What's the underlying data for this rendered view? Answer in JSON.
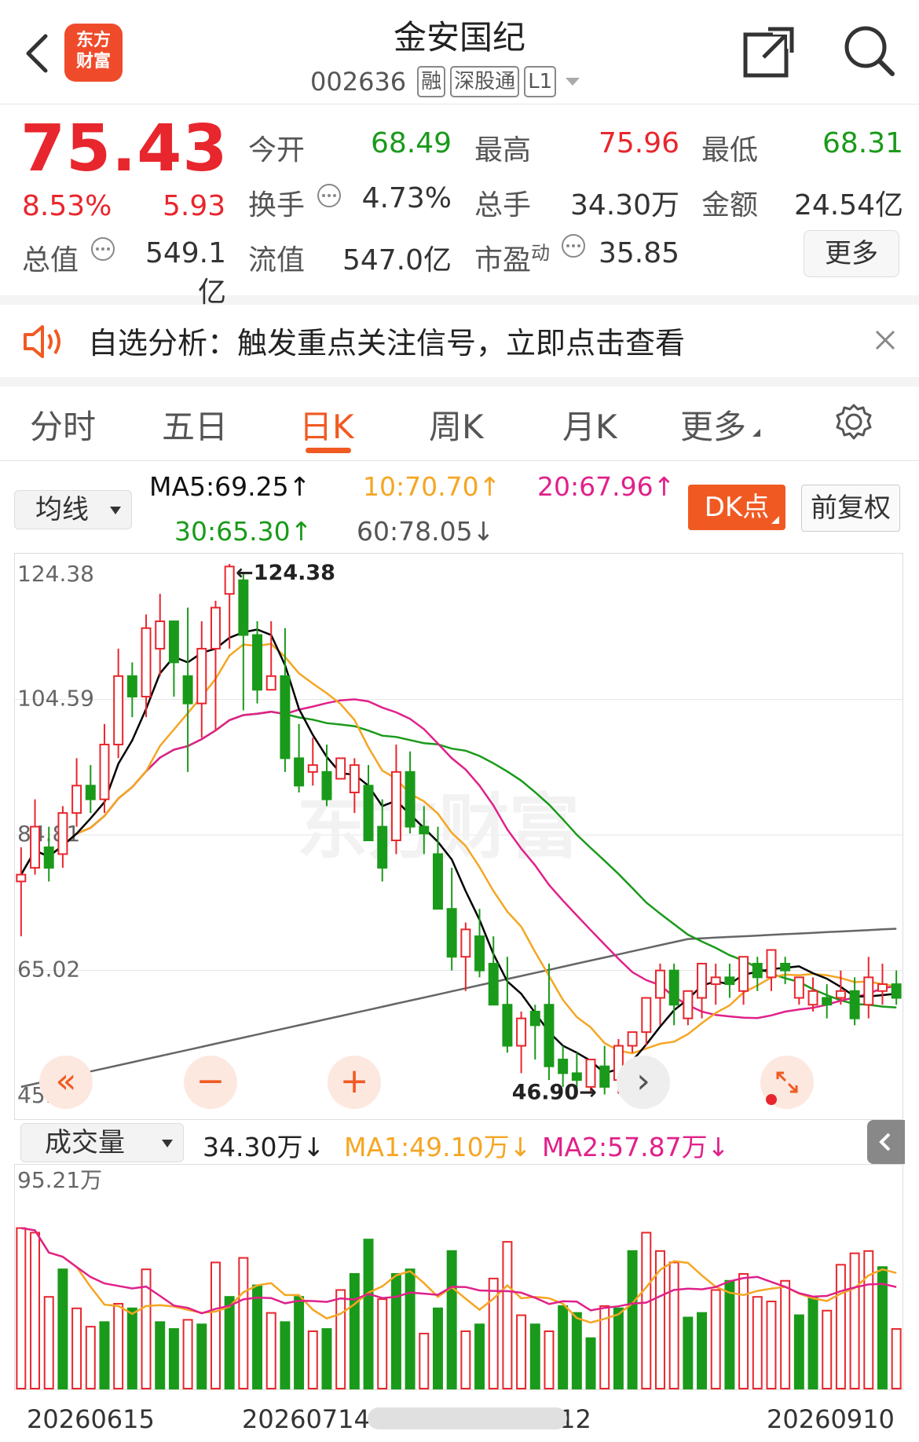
{
  "header": {
    "title": "金安国纪",
    "code": "002636",
    "tags": [
      "融",
      "深股通",
      "L1"
    ],
    "logo_line1": "东方",
    "logo_line2": "财富",
    "icons": [
      "back-arrow-icon",
      "share-icon",
      "search-icon"
    ]
  },
  "quote": {
    "price": "75.43",
    "change_pct": "8.53%",
    "change_amt": "5.93",
    "open_label": "今开",
    "open": "68.49",
    "high_label": "最高",
    "high": "75.96",
    "low_label": "最低",
    "low": "68.31",
    "turnover_label": "换手",
    "turnover": "4.73%",
    "volume_label": "总手",
    "volume": "34.30万",
    "amount_label": "金额",
    "amount": "24.54亿",
    "mktcap_label": "总值",
    "mktcap": "549.1亿",
    "float_label": "流值",
    "float_cap": "547.0亿",
    "pe_label": "市盈",
    "pe_sup": "动",
    "pe": "35.85",
    "more_label": "更多"
  },
  "alert": {
    "text": "自选分析：触发重点关注信号，立即点击查看"
  },
  "tabs": [
    "分时",
    "五日",
    "日K",
    "周K",
    "月K",
    "更多"
  ],
  "active_tab": "日K",
  "ma_bar": {
    "select_label": "均线",
    "ma5": "MA5:69.25↑",
    "ma10": "10:70.70↑",
    "ma20": "20:67.96↑",
    "ma30": "30:65.30↑",
    "ma60": "60:78.05↓",
    "dk_label": "DK点",
    "adjust_label": "前复权"
  },
  "volume_bar": {
    "select_label": "成交量",
    "current": "34.30万↓",
    "ma1": "MA1:49.10万↓",
    "ma2": "MA2:57.87万↓",
    "max_label": "95.21万"
  },
  "colors": {
    "up": "#e8262d",
    "down": "#1a9a1a",
    "accent": "#f05a22",
    "ma5": "#000000",
    "ma10": "#f5a623",
    "ma20": "#e0218a",
    "ma30": "#1a9a1a",
    "ma60": "#666666"
  },
  "chart_data": {
    "type": "candlestick",
    "y_ticks": [
      "124.38",
      "104.59",
      "84.81",
      "65.02",
      "45.23"
    ],
    "ylim": [
      45.23,
      124.38
    ],
    "max_marker": "←124.38",
    "min_marker": "46.90→",
    "x_ticks": [
      "20260615",
      "20260714",
      "20260812",
      "20260910"
    ],
    "candles": [
      [
        78,
        79,
        83,
        70
      ],
      [
        80,
        86,
        90,
        79
      ],
      [
        83,
        80,
        86,
        78
      ],
      [
        82,
        88,
        89,
        80
      ],
      [
        88,
        92,
        96,
        86
      ],
      [
        92,
        90,
        95,
        88
      ],
      [
        90,
        98,
        101,
        88
      ],
      [
        98,
        108,
        112,
        96
      ],
      [
        108,
        105,
        110,
        102
      ],
      [
        105,
        115,
        117,
        102
      ],
      [
        112,
        116,
        120,
        108
      ],
      [
        116,
        110,
        114,
        105
      ],
      [
        108,
        104,
        118,
        94
      ],
      [
        104,
        112,
        116,
        99
      ],
      [
        112,
        118,
        119,
        100
      ],
      [
        120,
        124,
        124.38,
        112
      ],
      [
        122,
        114,
        123,
        103
      ],
      [
        114,
        106,
        116,
        104
      ],
      [
        106,
        108,
        116,
        106
      ],
      [
        108,
        96,
        115,
        94
      ],
      [
        96,
        92,
        101,
        91
      ],
      [
        94,
        95,
        99,
        92
      ],
      [
        94,
        90,
        98,
        89
      ],
      [
        93,
        96,
        96,
        93
      ],
      [
        91,
        95,
        96,
        88
      ],
      [
        92,
        84,
        95,
        84
      ],
      [
        86,
        80,
        90,
        78
      ],
      [
        84,
        94,
        98,
        82
      ],
      [
        94,
        86,
        97,
        85
      ],
      [
        86,
        85,
        89,
        82
      ],
      [
        82,
        74,
        86,
        74
      ],
      [
        74,
        67,
        80,
        65
      ],
      [
        67,
        71,
        72,
        62
      ],
      [
        70,
        65,
        74,
        64
      ],
      [
        66,
        60,
        70,
        60
      ],
      [
        60,
        54,
        67,
        53
      ],
      [
        54,
        58,
        59,
        50
      ],
      [
        59,
        57,
        60,
        52
      ],
      [
        60,
        51,
        66,
        49
      ],
      [
        52,
        50,
        54,
        48
      ],
      [
        50,
        49,
        53,
        47
      ],
      [
        48,
        52,
        52,
        47.2
      ],
      [
        51,
        48,
        54,
        46.9
      ],
      [
        49,
        54,
        55,
        47
      ],
      [
        54,
        56,
        56,
        53
      ],
      [
        56,
        61,
        61,
        54
      ],
      [
        61,
        65,
        66,
        57
      ],
      [
        65,
        60,
        66,
        57
      ],
      [
        58,
        62,
        62,
        57
      ],
      [
        61,
        66,
        66,
        58
      ],
      [
        63,
        64,
        66,
        60
      ],
      [
        64,
        63,
        66,
        61
      ],
      [
        62,
        67,
        67,
        60
      ],
      [
        66,
        64,
        67,
        62
      ],
      [
        64,
        68,
        68,
        62
      ],
      [
        66,
        65,
        67,
        63
      ],
      [
        61,
        64,
        64,
        60
      ],
      [
        60,
        62,
        64,
        59
      ],
      [
        61,
        60,
        63,
        58
      ],
      [
        61,
        62,
        65,
        60
      ],
      [
        62,
        58,
        64,
        57
      ],
      [
        60,
        64,
        67,
        58
      ],
      [
        62,
        63,
        66,
        60
      ],
      [
        63,
        61,
        65,
        60
      ]
    ],
    "volumes": [
      [
        70,
        1
      ],
      [
        68,
        1
      ],
      [
        40,
        1
      ],
      [
        52,
        0
      ],
      [
        35,
        1
      ],
      [
        27,
        1
      ],
      [
        29,
        0
      ],
      [
        37,
        1
      ],
      [
        35,
        0
      ],
      [
        52,
        1
      ],
      [
        29,
        0
      ],
      [
        26,
        0
      ],
      [
        30,
        1
      ],
      [
        28,
        0
      ],
      [
        55,
        1
      ],
      [
        40,
        0
      ],
      [
        57,
        1
      ],
      [
        45,
        0
      ],
      [
        33,
        1
      ],
      [
        29,
        0
      ],
      [
        40,
        0
      ],
      [
        25,
        1
      ],
      [
        26,
        0
      ],
      [
        43,
        1
      ],
      [
        50,
        0
      ],
      [
        65,
        0
      ],
      [
        39,
        1
      ],
      [
        50,
        0
      ],
      [
        52,
        0
      ],
      [
        24,
        1
      ],
      [
        35,
        0
      ],
      [
        60,
        0
      ],
      [
        25,
        1
      ],
      [
        28,
        0
      ],
      [
        48,
        1
      ],
      [
        64,
        1
      ],
      [
        32,
        1
      ],
      [
        28,
        0
      ],
      [
        25,
        1
      ],
      [
        36,
        0
      ],
      [
        33,
        0
      ],
      [
        22,
        0
      ],
      [
        36,
        1
      ],
      [
        35,
        0
      ],
      [
        60,
        0
      ],
      [
        68,
        1
      ],
      [
        60,
        1
      ],
      [
        55,
        1
      ],
      [
        31,
        0
      ],
      [
        33,
        0
      ],
      [
        43,
        1
      ],
      [
        47,
        0
      ],
      [
        50,
        1
      ],
      [
        40,
        1
      ],
      [
        38,
        1
      ],
      [
        47,
        1
      ],
      [
        32,
        0
      ],
      [
        40,
        0
      ],
      [
        34,
        1
      ],
      [
        54,
        1
      ],
      [
        59,
        1
      ],
      [
        60,
        1
      ],
      [
        53,
        0
      ],
      [
        26,
        1
      ]
    ]
  }
}
